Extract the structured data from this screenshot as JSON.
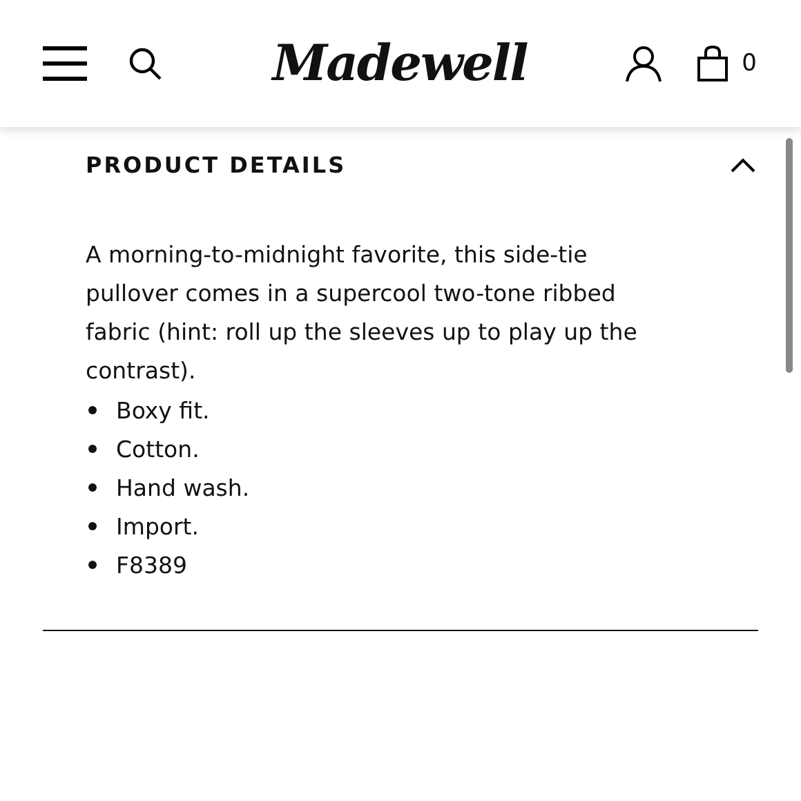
{
  "header": {
    "logo": "Madewell",
    "cart_count": "0"
  },
  "section": {
    "title": "PRODUCT DETAILS",
    "expanded": true,
    "description": "A morning-to-midnight favorite, this side-tie pullover comes in a supercool two-tone ribbed fabric (hint: roll up the sleeves up to play up the contrast).",
    "bullets": [
      "Boxy fit.",
      "Cotton.",
      "Hand wash.",
      "Import.",
      "F8389"
    ]
  }
}
